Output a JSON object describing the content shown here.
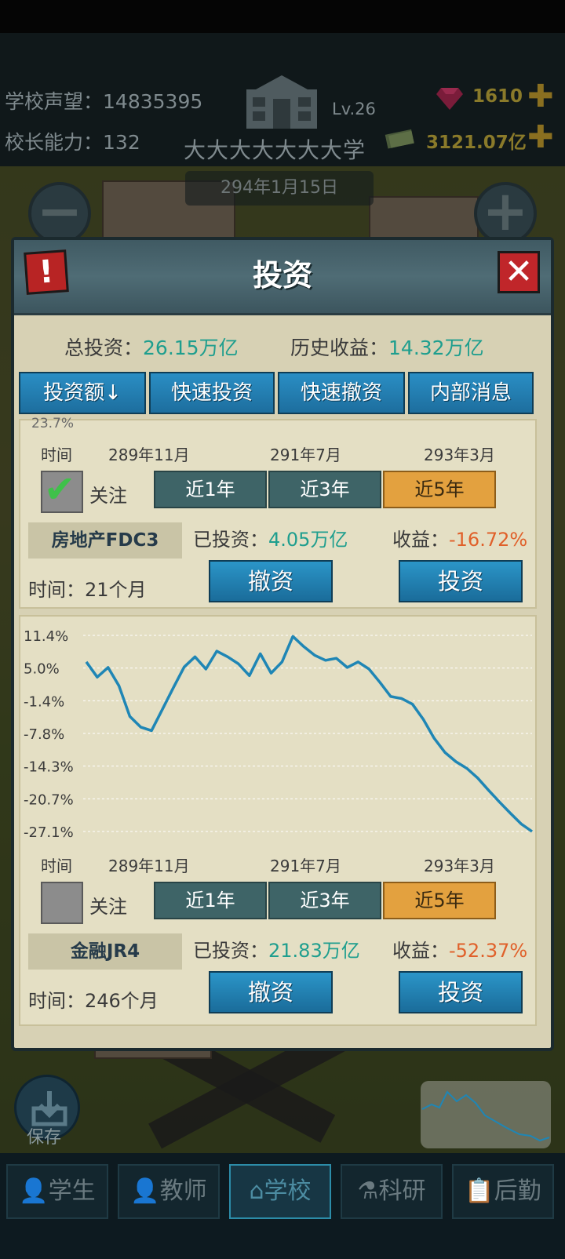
{
  "status": {
    "reputation_label": "学校声望：",
    "reputation_value": "14835395",
    "ability_label": "校长能力：",
    "ability_value": "132",
    "level": "Lv.26",
    "school_name": "大大大大大大大学",
    "gems": "1610",
    "money": "3121.07亿",
    "date": "294年1月15日"
  },
  "modal": {
    "title": "投资",
    "total_label": "总投资：",
    "total_value": "26.15万亿",
    "history_label": "历史收益：",
    "history_value": "14.32万亿",
    "tabs": [
      "投资额↓",
      "快速投资",
      "快速撤资",
      "内部消息"
    ]
  },
  "cards": [
    {
      "clipped_label": "23.7%",
      "time_axis_label": "时间",
      "x_ticks": [
        "289年11月",
        "291年7月",
        "293年3月"
      ],
      "followed": true,
      "follow_label": "关注",
      "ranges": [
        "近1年",
        "近3年",
        "近5年"
      ],
      "selected_range": "近5年",
      "name": "房地产FDC3",
      "invested_label": "已投资：",
      "invested_value": "4.05万亿",
      "profit_label": "收益：",
      "profit_value": "-16.72%",
      "duration": "时间：21个月",
      "withdraw_label": "撤资",
      "invest_label": "投资"
    },
    {
      "time_axis_label": "时间",
      "x_ticks": [
        "289年11月",
        "291年7月",
        "293年3月"
      ],
      "followed": false,
      "follow_label": "关注",
      "ranges": [
        "近1年",
        "近3年",
        "近5年"
      ],
      "selected_range": "近5年",
      "name": "金融JR4",
      "invested_label": "已投资：",
      "invested_value": "21.83万亿",
      "profit_label": "收益：",
      "profit_value": "-52.37%",
      "duration": "时间：246个月",
      "withdraw_label": "撤资",
      "invest_label": "投资"
    }
  ],
  "chart_data": {
    "type": "line",
    "y_ticks": [
      "11.4%",
      "5.0%",
      "-1.4%",
      "-7.8%",
      "-14.3%",
      "-20.7%",
      "-27.1%"
    ],
    "ylim": [
      -27.1,
      11.4
    ],
    "x_ticks": [
      "289年11月",
      "291年7月",
      "293年3月"
    ],
    "series": [
      {
        "color": "#1f86b5",
        "values": [
          6.2,
          3.2,
          5.1,
          1.5,
          -4.5,
          -6.6,
          -7.3,
          -3.1,
          1.1,
          5.2,
          7.2,
          4.8,
          8.3,
          7.2,
          5.8,
          3.5,
          7.8,
          4.0,
          6.2,
          11.2,
          9.2,
          7.5,
          6.5,
          6.9,
          5.1,
          6.2,
          4.8,
          2.2,
          -0.6,
          -1.0,
          -2.1,
          -5.1,
          -8.8,
          -11.6,
          -13.4,
          -14.7,
          -16.6,
          -19.0,
          -21.3,
          -23.5,
          -25.6,
          -27.1
        ]
      }
    ]
  },
  "bottom_nav": [
    "学生",
    "教师",
    "学校",
    "科研",
    "后勤"
  ],
  "active_nav": "学校",
  "save_label": "保存"
}
